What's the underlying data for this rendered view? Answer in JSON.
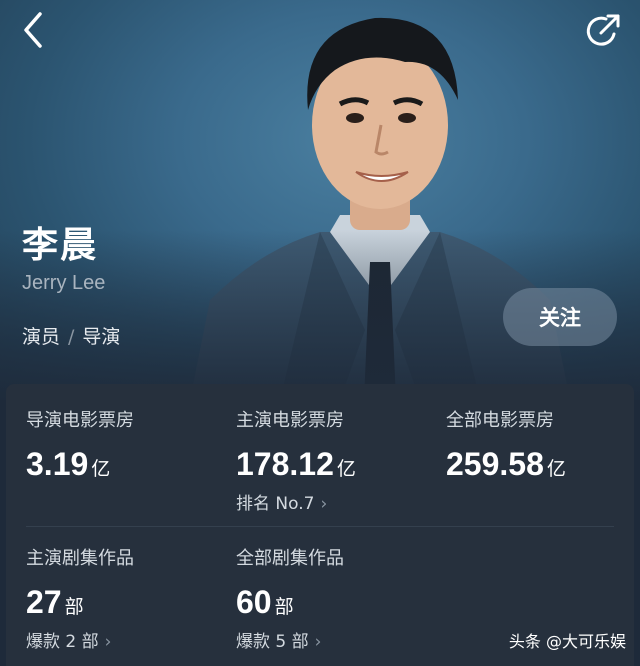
{
  "profile": {
    "name": "李晨",
    "english_name": "Jerry Lee",
    "roles": [
      "演员",
      "导演"
    ],
    "role_separator": "/",
    "follow_label": "关注"
  },
  "stats": {
    "director_box_office": {
      "label": "导演电影票房",
      "value": "3.19",
      "unit": "亿"
    },
    "lead_box_office": {
      "label": "主演电影票房",
      "value": "178.12",
      "unit": "亿",
      "rank": "排名 No.7"
    },
    "total_box_office": {
      "label": "全部电影票房",
      "value": "259.58",
      "unit": "亿"
    },
    "lead_series": {
      "label": "主演剧集作品",
      "value": "27",
      "unit": "部",
      "hits": "爆款 2 部"
    },
    "total_series": {
      "label": "全部剧集作品",
      "value": "60",
      "unit": "部",
      "hits": "爆款 5 部"
    }
  },
  "watermark": "头条 @大可乐娱",
  "icons": [
    "back-arrow-icon",
    "share-icon",
    "chevron-right-icon"
  ],
  "colors": {
    "hero_bg": "#3a6a8c",
    "card_bg": "#26303d",
    "follow_bg": "#7a8ca0"
  }
}
